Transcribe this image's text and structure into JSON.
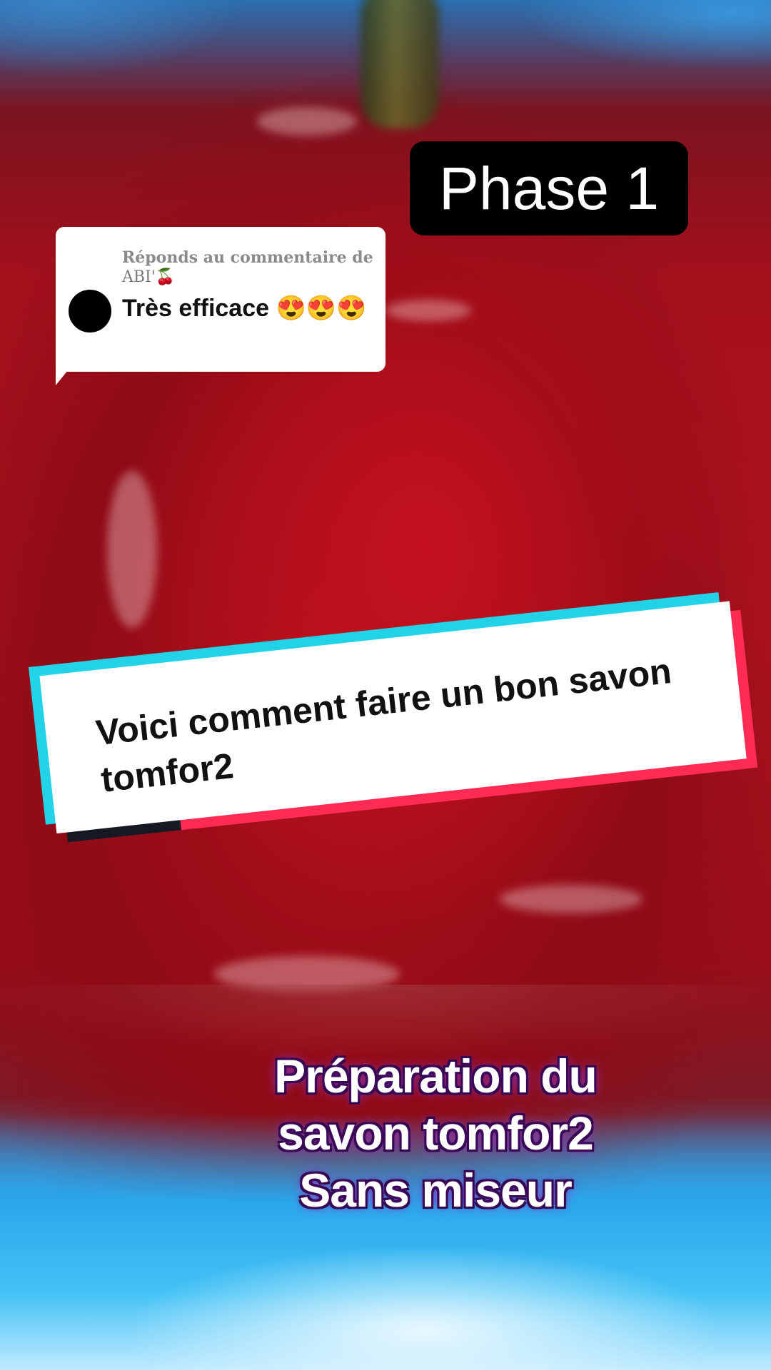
{
  "phase_badge": {
    "label": "Phase 1"
  },
  "reply_card": {
    "header": "Réponds au commentaire de",
    "username": "ABI'🍒",
    "comment": "Très efficace 😍😍😍"
  },
  "caption": {
    "text": "Voici comment faire un bon savon tomfor2"
  },
  "overlay": {
    "lines": [
      "Préparation du",
      "savon tomfor2",
      "Sans miseur"
    ]
  },
  "colors": {
    "caption_cyan": "#22d3e8",
    "caption_pink": "#fe2c55",
    "caption_dark": "#161823",
    "overlay_glow": "#9b3fd6"
  }
}
